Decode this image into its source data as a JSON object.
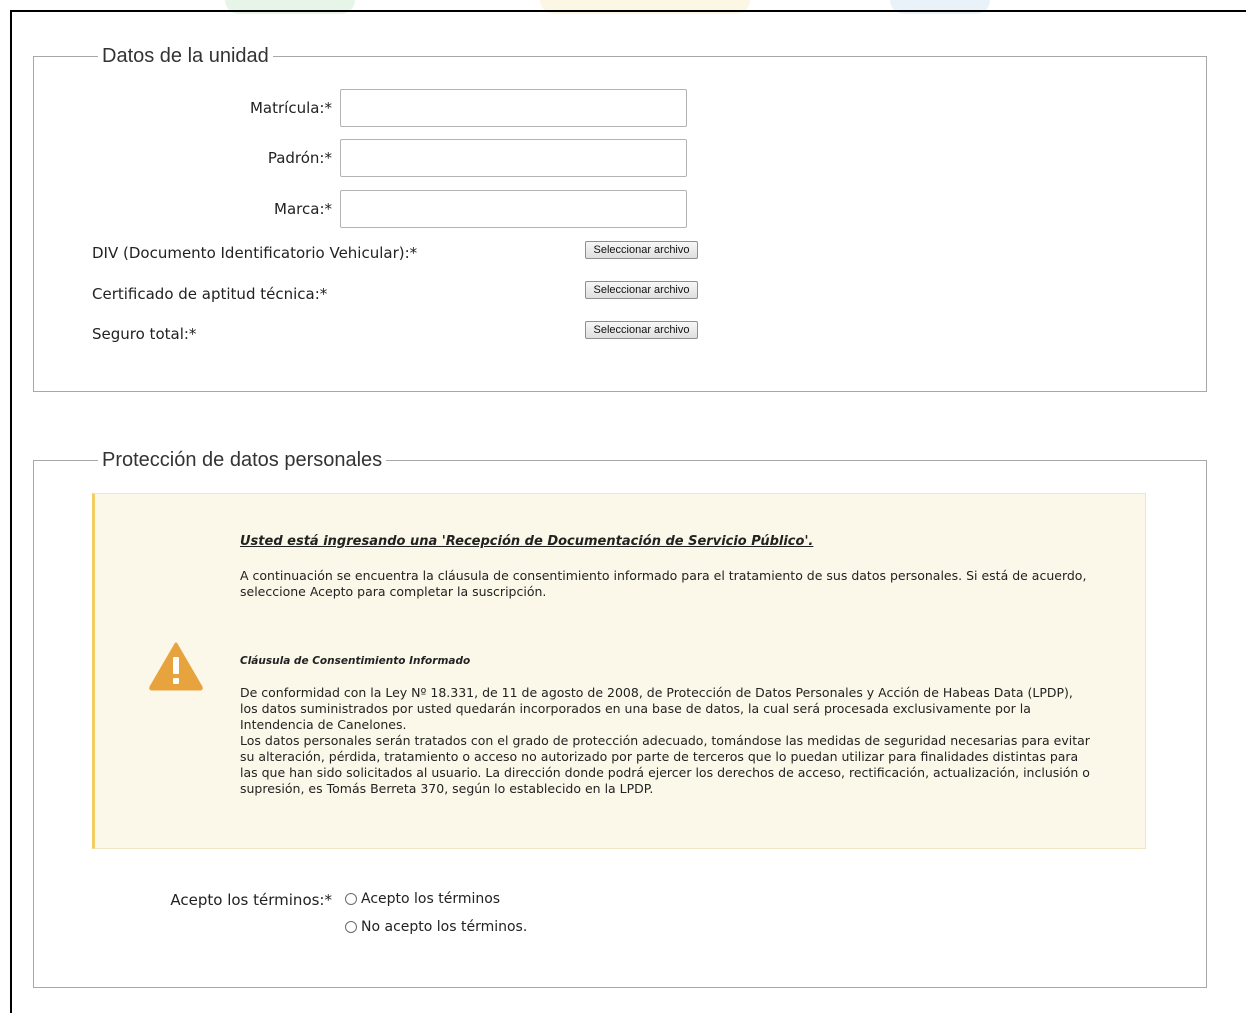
{
  "unit_section": {
    "legend": "Datos de la unidad",
    "matricula_label": "Matrícula:*",
    "padron_label": "Padrón:*",
    "marca_label": "Marca:*",
    "div_label": "DIV (Documento Identificatorio Vehicular):*",
    "cat_label": "Certificado de aptitud técnica:*",
    "seguro_label": "Seguro total:*",
    "file_button_label": "Seleccionar archivo",
    "matricula_value": "",
    "padron_value": "",
    "marca_value": ""
  },
  "privacy_section": {
    "legend": "Protección de datos personales",
    "notice": {
      "title": "Usted está ingresando una 'Recepción de Documentación de Servicio Público'.",
      "intro_line1": "A continuación se encuentra la cláusula de consentimiento informado para el tratamiento de sus datos personales. Si está de acuerdo,",
      "intro_line2": "seleccione Acepto para completar la suscripción.",
      "clause_title": "Cláusula de Consentimiento Informado",
      "clause_lines": [
        "De conformidad con la Ley Nº 18.331, de 11 de agosto de 2008, de Protección de Datos Personales y Acción de Habeas Data (LPDP),",
        "los datos suministrados por usted quedarán incorporados en una base de datos, la cual será procesada exclusivamente por la",
        "Intendencia de Canelones.",
        "Los datos personales serán tratados con el grado de protección adecuado, tomándose las medidas de seguridad necesarias para evitar",
        "su alteración, pérdida, tratamiento o acceso no autorizado por parte de terceros que lo puedan utilizar para finalidades distintas para",
        "las que han sido solicitados al usuario. La dirección donde podrá ejercer los derechos de acceso, rectificación, actualización, inclusión o",
        "supresión, es Tomás Berreta 370, según lo establecido en la LPDP."
      ]
    },
    "terms_label": "Acepto los términos:*",
    "accept_option": "Acepto los términos",
    "reject_option": "No acepto los términos."
  },
  "colors": {
    "warning_icon": "#e7a33e",
    "notice_bg": "#fcf8e9",
    "notice_accent": "#f3cd63"
  }
}
